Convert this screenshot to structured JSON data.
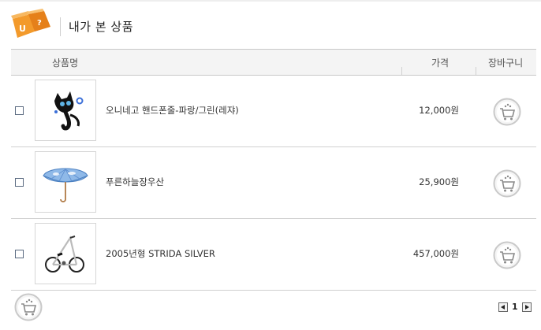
{
  "header": {
    "title": "내가 본 상품",
    "logo_icon": "orange-box-logo-icon",
    "logo_letters": [
      "U",
      "?"
    ]
  },
  "table": {
    "columns": {
      "name": "상품명",
      "price": "가격",
      "cart": "장바구니"
    },
    "rows": [
      {
        "name": "오니네고 핸드폰줄-파랑/그린(레쟈)",
        "price": "12,000원",
        "image_icon": "black-cat-phone-strap-image"
      },
      {
        "name": "푸른하늘장우산",
        "price": "25,900원",
        "image_icon": "sky-umbrella-image"
      },
      {
        "name": "2005년형 STRIDA SILVER",
        "price": "457,000원",
        "image_icon": "strida-bicycle-image"
      }
    ]
  },
  "pagination": {
    "current_page": "1"
  },
  "colors": {
    "accent": "#f08a1c",
    "border": "#d0d0d0",
    "header_bg": "#f4f4f4"
  }
}
